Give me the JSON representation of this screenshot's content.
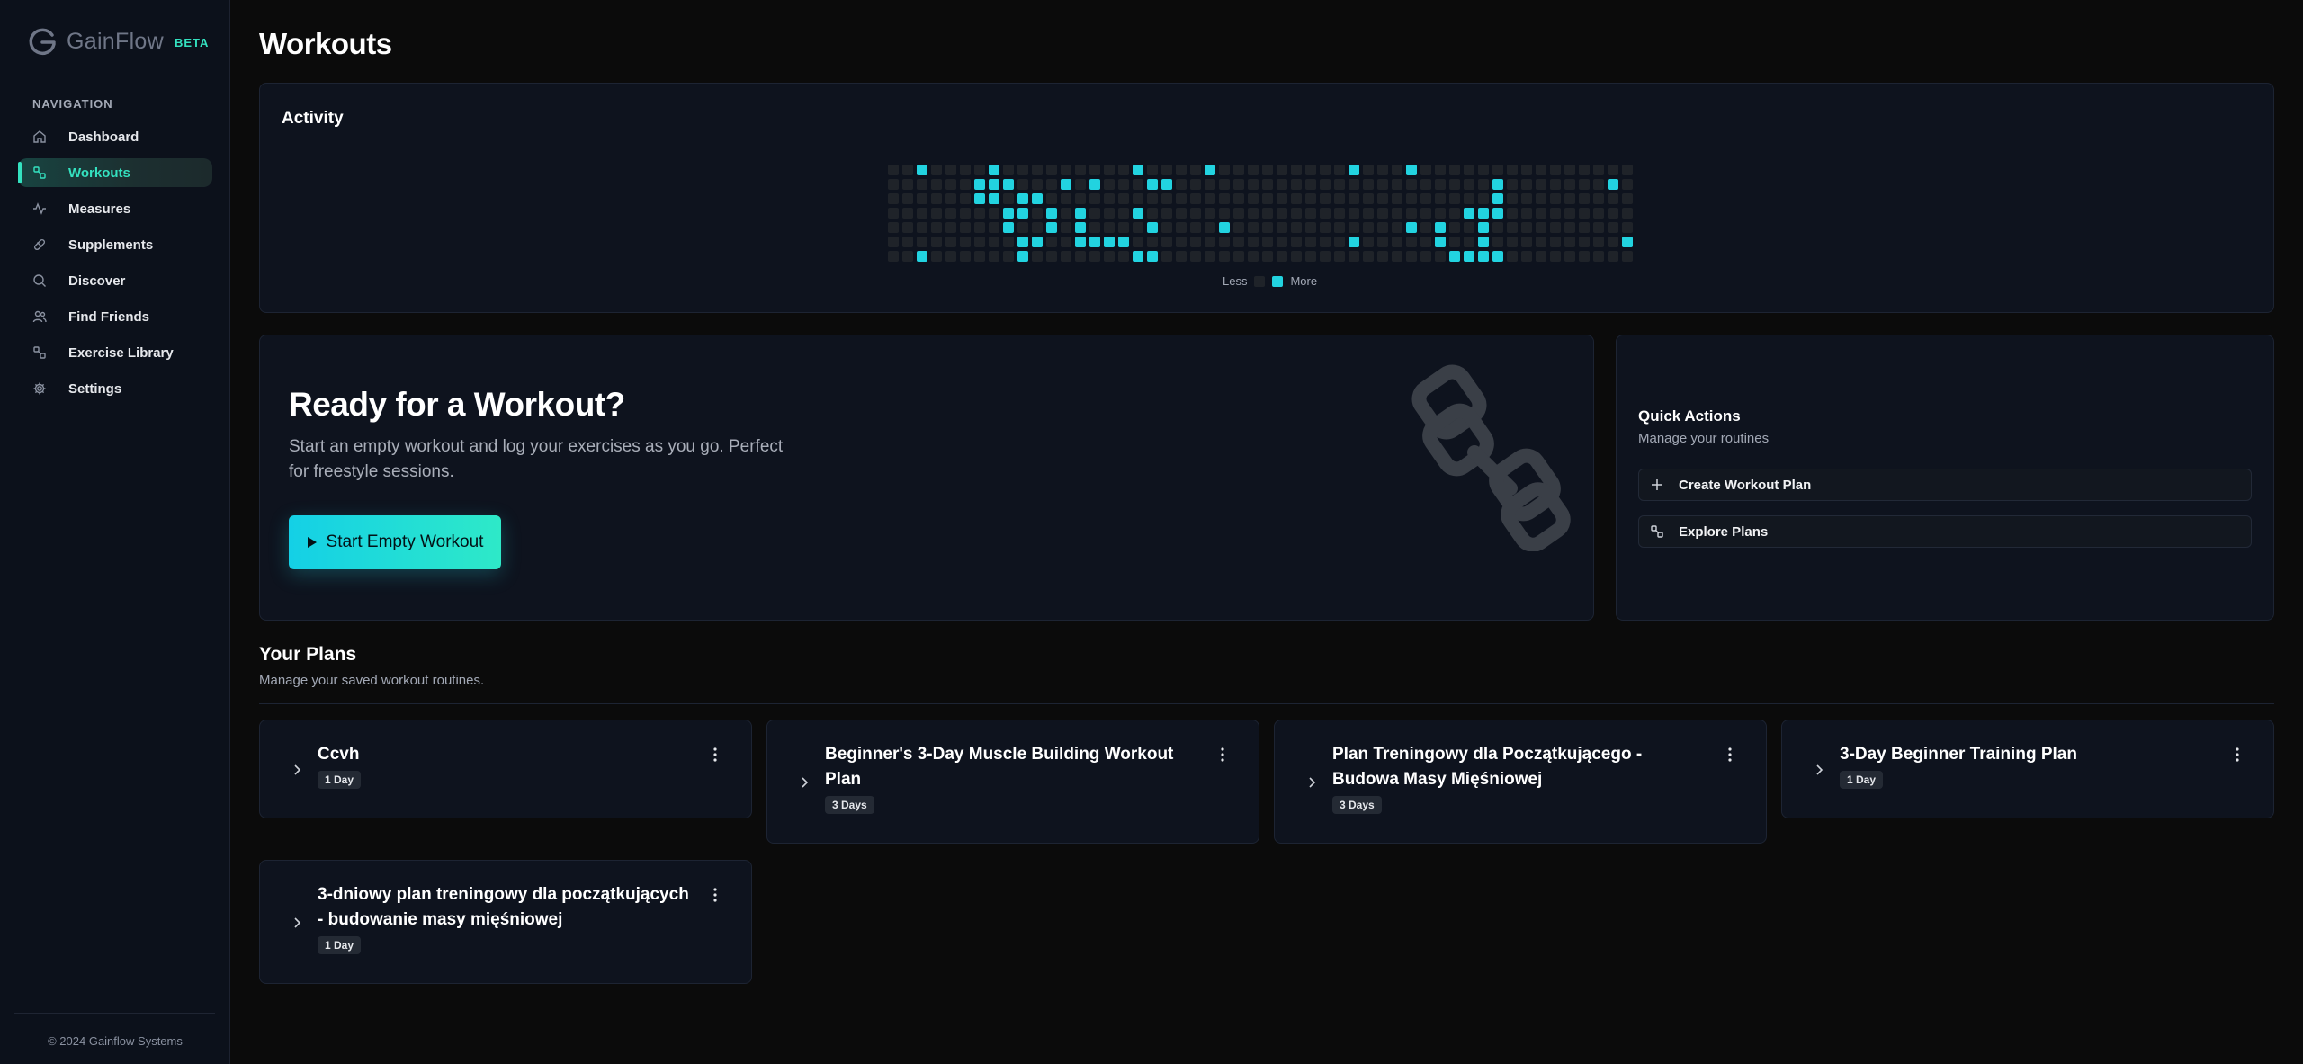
{
  "brand": {
    "name": "GainFlow",
    "badge": "BETA"
  },
  "sidebar": {
    "heading": "NAVIGATION",
    "items": [
      {
        "label": "Dashboard",
        "icon": "home-icon"
      },
      {
        "label": "Workouts",
        "icon": "dumbbell-icon",
        "active": true
      },
      {
        "label": "Measures",
        "icon": "activity-icon"
      },
      {
        "label": "Supplements",
        "icon": "pill-icon"
      },
      {
        "label": "Discover",
        "icon": "search-icon"
      },
      {
        "label": "Find Friends",
        "icon": "users-icon"
      },
      {
        "label": "Exercise Library",
        "icon": "dumbbell-icon"
      },
      {
        "label": "Settings",
        "icon": "gear-icon"
      }
    ],
    "footer": "© 2024 Gainflow Systems"
  },
  "page": {
    "title": "Workouts"
  },
  "activity": {
    "title": "Activity",
    "legend_less": "Less",
    "legend_more": "More",
    "colors": {
      "empty": "#1f2329",
      "active": "#22d3e0"
    },
    "weeks": 52,
    "active_cells": [
      [
        2,
        0
      ],
      [
        2,
        6
      ],
      [
        6,
        2
      ],
      [
        6,
        1
      ],
      [
        7,
        1
      ],
      [
        7,
        0
      ],
      [
        7,
        2
      ],
      [
        8,
        3
      ],
      [
        8,
        4
      ],
      [
        8,
        1
      ],
      [
        9,
        3
      ],
      [
        9,
        2
      ],
      [
        9,
        5
      ],
      [
        9,
        6
      ],
      [
        10,
        2
      ],
      [
        10,
        5
      ],
      [
        11,
        3
      ],
      [
        11,
        4
      ],
      [
        12,
        1
      ],
      [
        13,
        4
      ],
      [
        13,
        3
      ],
      [
        13,
        5
      ],
      [
        14,
        1
      ],
      [
        14,
        5
      ],
      [
        15,
        5
      ],
      [
        16,
        5
      ],
      [
        17,
        0
      ],
      [
        17,
        3
      ],
      [
        17,
        6
      ],
      [
        18,
        1
      ],
      [
        18,
        6
      ],
      [
        18,
        4
      ],
      [
        19,
        1
      ],
      [
        22,
        0
      ],
      [
        23,
        4
      ],
      [
        32,
        0
      ],
      [
        32,
        5
      ],
      [
        36,
        4
      ],
      [
        36,
        0
      ],
      [
        38,
        4
      ],
      [
        38,
        5
      ],
      [
        40,
        3
      ],
      [
        39,
        6
      ],
      [
        41,
        4
      ],
      [
        40,
        6
      ],
      [
        41,
        3
      ],
      [
        41,
        5
      ],
      [
        42,
        2
      ],
      [
        42,
        3
      ],
      [
        41,
        6
      ],
      [
        42,
        1
      ],
      [
        42,
        6
      ],
      [
        42,
        3
      ],
      [
        50,
        1
      ],
      [
        51,
        5
      ]
    ]
  },
  "ready": {
    "title": "Ready for a Workout?",
    "subtitle": "Start an empty workout and log your exercises as you go. Perfect for freestyle sessions.",
    "button_label": "Start Empty Workout"
  },
  "quick_actions": {
    "title": "Quick Actions",
    "subtitle": "Manage your routines",
    "items": [
      {
        "label": "Create Workout Plan",
        "icon": "plus-icon"
      },
      {
        "label": "Explore Plans",
        "icon": "dumbbell-icon"
      }
    ]
  },
  "plans": {
    "title": "Your Plans",
    "subtitle": "Manage your saved workout routines.",
    "items": [
      {
        "name": "Ccvh",
        "days": "1 Day"
      },
      {
        "name": "Beginner's 3-Day Muscle Building Workout Plan",
        "days": "3 Days"
      },
      {
        "name": "Plan Treningowy dla Początkującego - Budowa Masy Mięśniowej",
        "days": "3 Days"
      },
      {
        "name": "3-Day Beginner Training Plan",
        "days": "1 Day"
      },
      {
        "name": "3-dniowy plan treningowy dla początkujących - budowanie masy mięśniowej",
        "days": "1 Day"
      }
    ]
  }
}
